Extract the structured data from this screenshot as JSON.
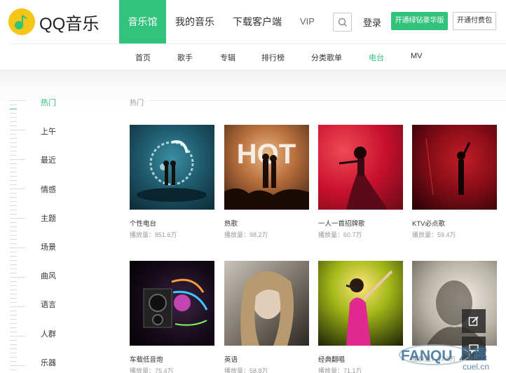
{
  "brand": {
    "name": "QQ音乐"
  },
  "nav": {
    "items": [
      "音乐馆",
      "我的音乐",
      "下载客户端",
      "VIP"
    ],
    "login": "登录",
    "green_button": "开通绿钻豪华版",
    "white_button": "开通付费包"
  },
  "subnav": [
    "首页",
    "歌手",
    "专辑",
    "排行榜",
    "分类歌单",
    "电台",
    "MV"
  ],
  "sidebar": {
    "categories": [
      "热门",
      "上午",
      "最近",
      "情感",
      "主题",
      "场景",
      "曲风",
      "语言",
      "人群",
      "乐器"
    ]
  },
  "section": {
    "title": "热门"
  },
  "cards": [
    {
      "title": "个性电台",
      "plays": "播放量：851.6万"
    },
    {
      "title": "热歌",
      "plays": "播放量：98.2万"
    },
    {
      "title": "一人一首招牌歌",
      "plays": "播放量：60.7万"
    },
    {
      "title": "KTV必点歌",
      "plays": "播放量：59.4万"
    },
    {
      "title": "车载低音炮",
      "plays": "播放量：75.4万"
    },
    {
      "title": "英语",
      "plays": "播放量：58.8万"
    },
    {
      "title": "经典翻唱",
      "plays": "播放量：71.1万"
    },
    {
      "title": "",
      "plays": "播放量：97.2万"
    }
  ],
  "hot_image_text": "HOT",
  "watermark": {
    "brand": "FANQU",
    "brand2": "凡趣",
    "site": "cuel.cn"
  },
  "colors": {
    "accent": "#31c27c",
    "logo_yellow": "#f5c518"
  },
  "icons": [
    "search-icon",
    "edit-icon",
    "chat-icon"
  ]
}
